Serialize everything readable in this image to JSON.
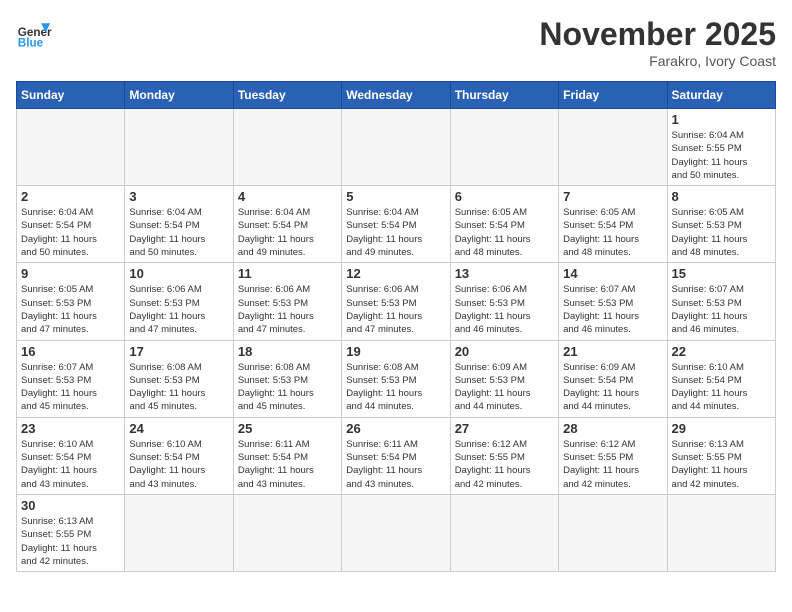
{
  "header": {
    "logo_general": "General",
    "logo_blue": "Blue",
    "month_title": "November 2025",
    "location": "Farakro, Ivory Coast"
  },
  "days_of_week": [
    "Sunday",
    "Monday",
    "Tuesday",
    "Wednesday",
    "Thursday",
    "Friday",
    "Saturday"
  ],
  "weeks": [
    [
      {
        "day": "",
        "info": ""
      },
      {
        "day": "",
        "info": ""
      },
      {
        "day": "",
        "info": ""
      },
      {
        "day": "",
        "info": ""
      },
      {
        "day": "",
        "info": ""
      },
      {
        "day": "",
        "info": ""
      },
      {
        "day": "1",
        "info": "Sunrise: 6:04 AM\nSunset: 5:55 PM\nDaylight: 11 hours\nand 50 minutes."
      }
    ],
    [
      {
        "day": "2",
        "info": "Sunrise: 6:04 AM\nSunset: 5:54 PM\nDaylight: 11 hours\nand 50 minutes."
      },
      {
        "day": "3",
        "info": "Sunrise: 6:04 AM\nSunset: 5:54 PM\nDaylight: 11 hours\nand 50 minutes."
      },
      {
        "day": "4",
        "info": "Sunrise: 6:04 AM\nSunset: 5:54 PM\nDaylight: 11 hours\nand 49 minutes."
      },
      {
        "day": "5",
        "info": "Sunrise: 6:04 AM\nSunset: 5:54 PM\nDaylight: 11 hours\nand 49 minutes."
      },
      {
        "day": "6",
        "info": "Sunrise: 6:05 AM\nSunset: 5:54 PM\nDaylight: 11 hours\nand 48 minutes."
      },
      {
        "day": "7",
        "info": "Sunrise: 6:05 AM\nSunset: 5:54 PM\nDaylight: 11 hours\nand 48 minutes."
      },
      {
        "day": "8",
        "info": "Sunrise: 6:05 AM\nSunset: 5:53 PM\nDaylight: 11 hours\nand 48 minutes."
      }
    ],
    [
      {
        "day": "9",
        "info": "Sunrise: 6:05 AM\nSunset: 5:53 PM\nDaylight: 11 hours\nand 47 minutes."
      },
      {
        "day": "10",
        "info": "Sunrise: 6:06 AM\nSunset: 5:53 PM\nDaylight: 11 hours\nand 47 minutes."
      },
      {
        "day": "11",
        "info": "Sunrise: 6:06 AM\nSunset: 5:53 PM\nDaylight: 11 hours\nand 47 minutes."
      },
      {
        "day": "12",
        "info": "Sunrise: 6:06 AM\nSunset: 5:53 PM\nDaylight: 11 hours\nand 47 minutes."
      },
      {
        "day": "13",
        "info": "Sunrise: 6:06 AM\nSunset: 5:53 PM\nDaylight: 11 hours\nand 46 minutes."
      },
      {
        "day": "14",
        "info": "Sunrise: 6:07 AM\nSunset: 5:53 PM\nDaylight: 11 hours\nand 46 minutes."
      },
      {
        "day": "15",
        "info": "Sunrise: 6:07 AM\nSunset: 5:53 PM\nDaylight: 11 hours\nand 46 minutes."
      }
    ],
    [
      {
        "day": "16",
        "info": "Sunrise: 6:07 AM\nSunset: 5:53 PM\nDaylight: 11 hours\nand 45 minutes."
      },
      {
        "day": "17",
        "info": "Sunrise: 6:08 AM\nSunset: 5:53 PM\nDaylight: 11 hours\nand 45 minutes."
      },
      {
        "day": "18",
        "info": "Sunrise: 6:08 AM\nSunset: 5:53 PM\nDaylight: 11 hours\nand 45 minutes."
      },
      {
        "day": "19",
        "info": "Sunrise: 6:08 AM\nSunset: 5:53 PM\nDaylight: 11 hours\nand 44 minutes."
      },
      {
        "day": "20",
        "info": "Sunrise: 6:09 AM\nSunset: 5:53 PM\nDaylight: 11 hours\nand 44 minutes."
      },
      {
        "day": "21",
        "info": "Sunrise: 6:09 AM\nSunset: 5:54 PM\nDaylight: 11 hours\nand 44 minutes."
      },
      {
        "day": "22",
        "info": "Sunrise: 6:10 AM\nSunset: 5:54 PM\nDaylight: 11 hours\nand 44 minutes."
      }
    ],
    [
      {
        "day": "23",
        "info": "Sunrise: 6:10 AM\nSunset: 5:54 PM\nDaylight: 11 hours\nand 43 minutes."
      },
      {
        "day": "24",
        "info": "Sunrise: 6:10 AM\nSunset: 5:54 PM\nDaylight: 11 hours\nand 43 minutes."
      },
      {
        "day": "25",
        "info": "Sunrise: 6:11 AM\nSunset: 5:54 PM\nDaylight: 11 hours\nand 43 minutes."
      },
      {
        "day": "26",
        "info": "Sunrise: 6:11 AM\nSunset: 5:54 PM\nDaylight: 11 hours\nand 43 minutes."
      },
      {
        "day": "27",
        "info": "Sunrise: 6:12 AM\nSunset: 5:55 PM\nDaylight: 11 hours\nand 42 minutes."
      },
      {
        "day": "28",
        "info": "Sunrise: 6:12 AM\nSunset: 5:55 PM\nDaylight: 11 hours\nand 42 minutes."
      },
      {
        "day": "29",
        "info": "Sunrise: 6:13 AM\nSunset: 5:55 PM\nDaylight: 11 hours\nand 42 minutes."
      }
    ],
    [
      {
        "day": "30",
        "info": "Sunrise: 6:13 AM\nSunset: 5:55 PM\nDaylight: 11 hours\nand 42 minutes."
      },
      {
        "day": "",
        "info": ""
      },
      {
        "day": "",
        "info": ""
      },
      {
        "day": "",
        "info": ""
      },
      {
        "day": "",
        "info": ""
      },
      {
        "day": "",
        "info": ""
      },
      {
        "day": "",
        "info": ""
      }
    ]
  ]
}
